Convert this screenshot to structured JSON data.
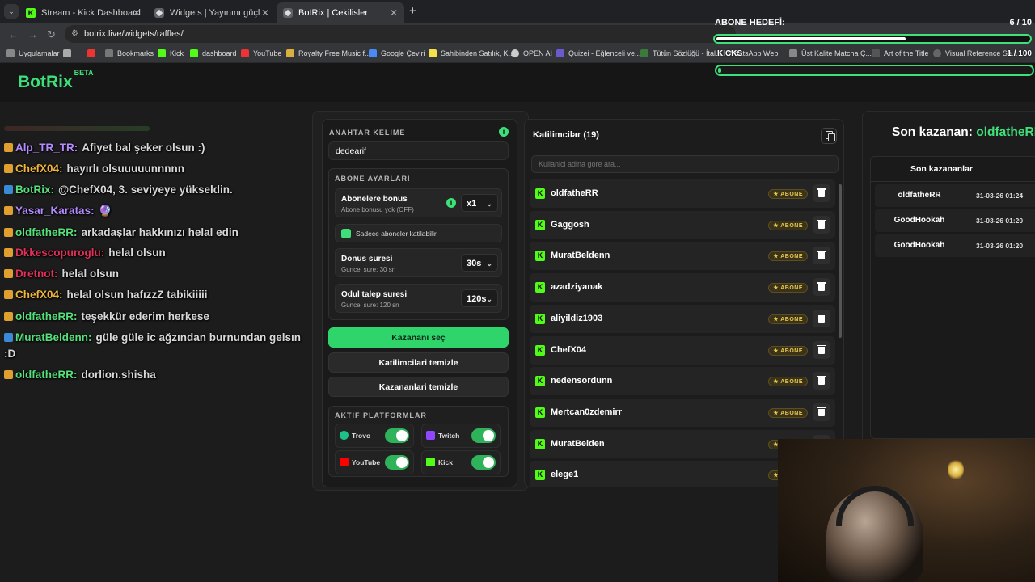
{
  "browser": {
    "tabs": [
      {
        "label": "Stream - Kick Dashboard",
        "icon": "kick-icon"
      },
      {
        "label": "Widgets | Yayınını güçlendirmek",
        "icon": "botrix-icon"
      },
      {
        "label": "BotRix | Cekilisler",
        "icon": "botrix-icon"
      }
    ],
    "new_tab": "+",
    "url": "botrix.live/widgets/raffles/",
    "bookmarks": [
      "Uygulamalar",
      "Bookmarks",
      "Kick",
      "dashboard",
      "YouTube",
      "Royalty Free Music f...",
      "Google Çeviri",
      "Sahibinden Satılık, K...",
      "OPEN AI",
      "Quizei - Eğlenceli ve...",
      "Tütün Sözlüğü - İtal...",
      "WhatsApp Web",
      "Üst Kalite Matcha Ç...",
      "Art of the Title",
      "Visual Reference Se..."
    ]
  },
  "app": {
    "logo": "BotRix",
    "logo_badge": "BETA"
  },
  "chat": [
    {
      "user": "Alp_TR_TR:",
      "text": "Afiyet bal şeker olsun :)",
      "color": "#b38cff"
    },
    {
      "user": "ChefX04:",
      "text": "hayırlı olsuuuuunnnnn",
      "color": "#f0b63c"
    },
    {
      "user": "BotRix:",
      "text": "@ChefX04, 3. seviyeye yükseldin.",
      "color": "#56e07c"
    },
    {
      "user": "Yasar_Karatas:",
      "text": "🔮",
      "color": "#b38cff"
    },
    {
      "user": "oldfatheRR:",
      "text": "arkadaşlar hakkınızı helal edin",
      "color": "#56e07c"
    },
    {
      "user": "Dkkescopuroglu:",
      "text": "helal olsun",
      "color": "#e0305a"
    },
    {
      "user": "Dretnot:",
      "text": "helal olsun",
      "color": "#e0305a"
    },
    {
      "user": "ChefX04:",
      "text": "helal olsun hafızzZ tabikiiiii",
      "color": "#f0b63c"
    },
    {
      "user": "oldfatheRR:",
      "text": "teşekkür ederim herkese",
      "color": "#56e07c"
    },
    {
      "user": "MuratBeldenn:",
      "text": "güle güle ic ağzından burnundan gelsın",
      "color": "#56e07c"
    },
    {
      "user": "",
      "text": ":D",
      "color": "#56e07c"
    },
    {
      "user": "oldfatheRR:",
      "text": "dorlion.shisha",
      "color": "#56e07c"
    }
  ],
  "settings": {
    "keyword_label": "ANAHTAR KELIME",
    "info": "i",
    "keyword_value": "dedearif",
    "sub_settings_label": "ABONE AYARLARI",
    "bonus_title": "Abonelere bonus",
    "bonus_sub": "Abone bonusu yok (OFF)",
    "bonus_value": "x1",
    "only_subs": "Sadece aboneler katilabilir",
    "spin_title": "Donus suresi",
    "spin_sub": "Guncel sure: 30 sn",
    "spin_value": "30s",
    "claim_title": "Odul talep suresi",
    "claim_sub": "Guncel sure: 120 sn",
    "claim_value": "120s",
    "pick_winner": "Kazananı seç",
    "clear_participants": "Katilimcilari temizle",
    "clear_winners": "Kazananlari temizle",
    "platforms_label": "AKTIF PLATFORMLAR",
    "platforms": [
      {
        "name": "Trovo",
        "color": "#1bc08a",
        "enabled": true
      },
      {
        "name": "Twitch",
        "color": "#9147ff",
        "enabled": true
      },
      {
        "name": "YouTube",
        "color": "#ff0000",
        "enabled": true
      },
      {
        "name": "Kick",
        "color": "#53fc18",
        "enabled": true
      }
    ]
  },
  "participants": {
    "title": "Katilimcilar (19)",
    "search_placeholder": "Kullanici adina gore ara...",
    "sub_badge": "★ ABONE",
    "rows": [
      "oldfatheRR",
      "Gaggosh",
      "MuratBeldenn",
      "azadziyanak",
      "aliyildiz1903",
      "ChefX04",
      "nedensordunn",
      "Mertcan0zdemirr",
      "MuratBelden",
      "elege1"
    ]
  },
  "winner": {
    "label": "Son kazanan:",
    "name": "oldfatheRR",
    "list_title": "Son kazananlar",
    "rows": [
      {
        "name": "oldfatheRR",
        "date": "31-03-26 01:24"
      },
      {
        "name": "GoodHookah",
        "date": "31-03-26 01:20"
      },
      {
        "name": "GoodHookah",
        "date": "31-03-26 01:20"
      }
    ]
  },
  "overlay": {
    "goal_label": "ABONE HEDEFİ:",
    "goal_count": "6 / 10",
    "goal_progress": 0.6,
    "kicks_label": "KICKS",
    "kicks_count": "1 / 100",
    "kicks_progress": 0.01
  },
  "colors": {
    "accent": "#3ee07a",
    "kick": "#53fc18",
    "gold": "#e9c84d"
  }
}
